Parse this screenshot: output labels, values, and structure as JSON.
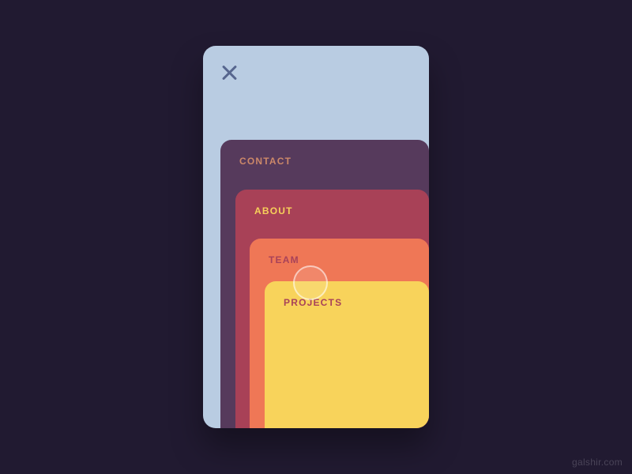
{
  "menu": {
    "items": [
      {
        "label": "CONTACT"
      },
      {
        "label": "ABOUT"
      },
      {
        "label": "TEAM"
      },
      {
        "label": "PROJECTS"
      }
    ]
  },
  "credit": "galshir.com"
}
